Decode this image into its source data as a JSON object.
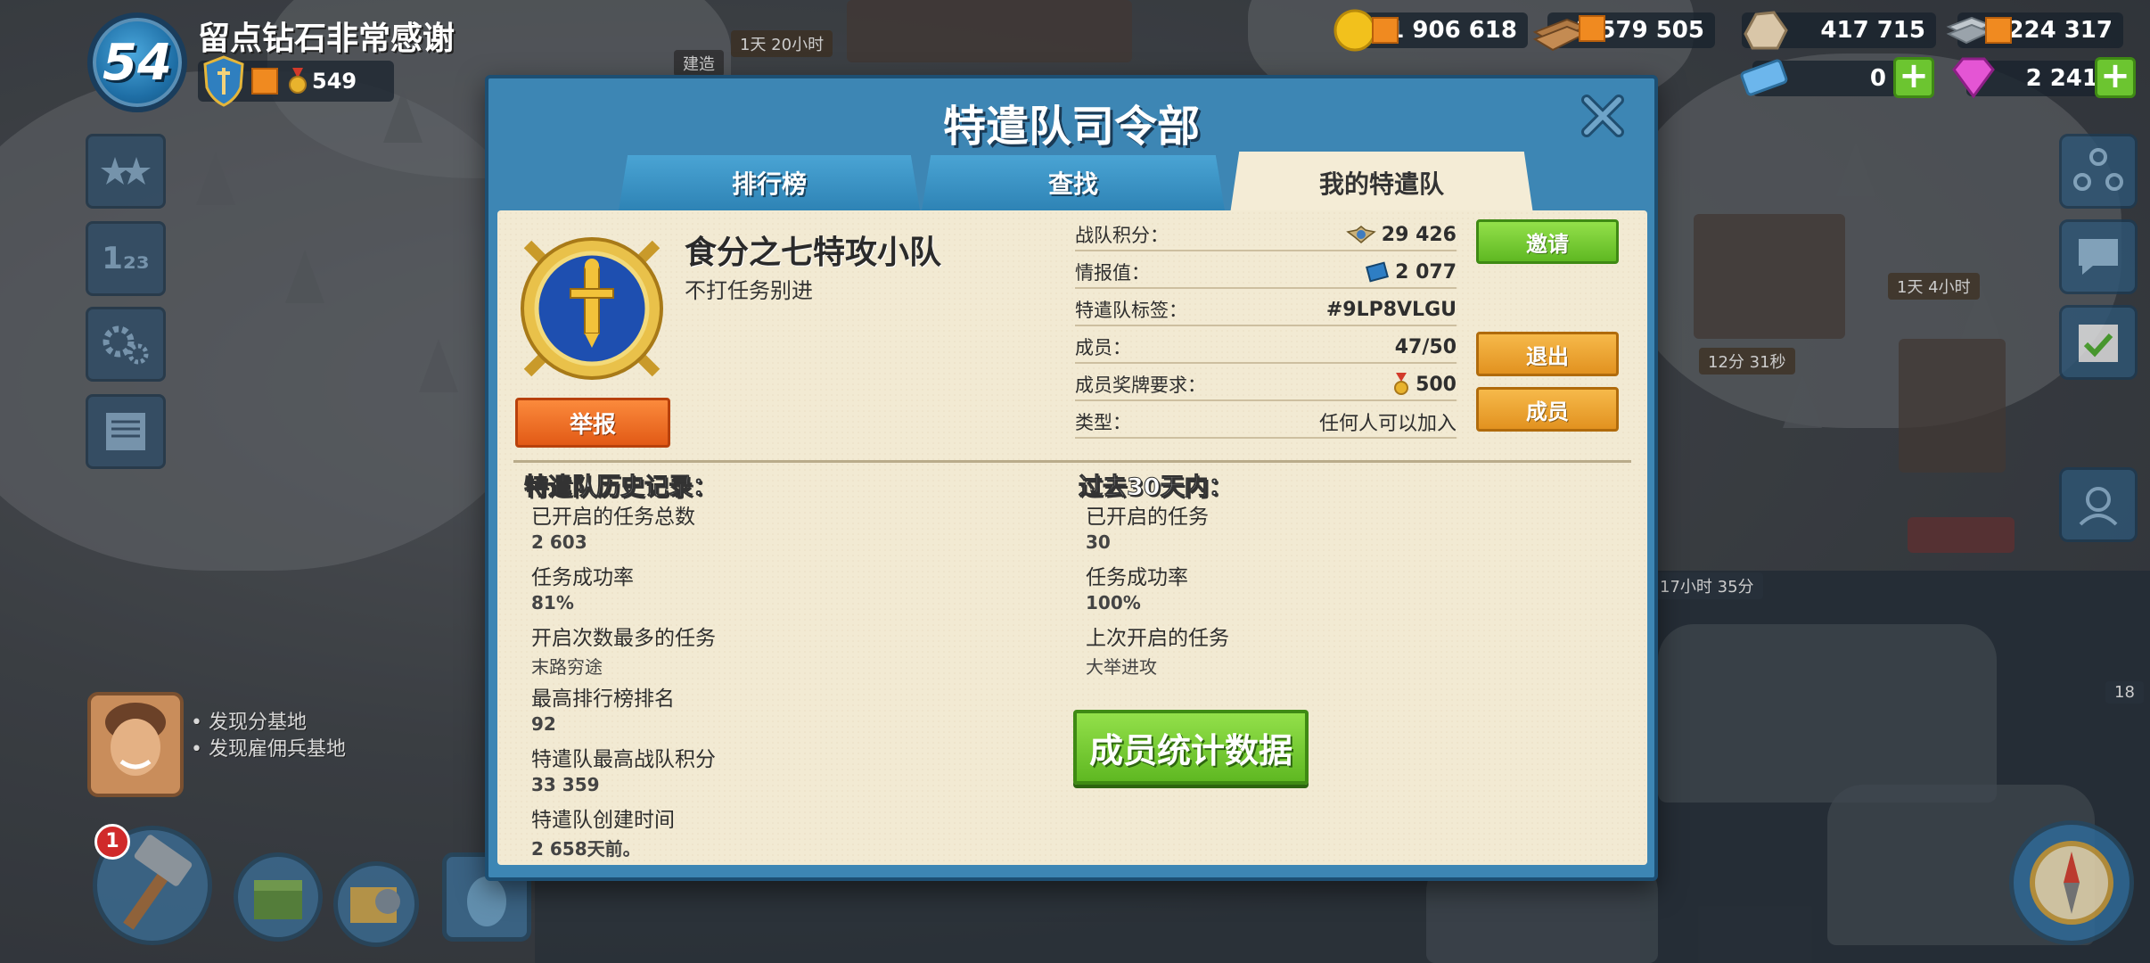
{
  "hud": {
    "level": "54",
    "player_name": "留点钻石非常感谢",
    "medal_count": "549",
    "advisor_lines": [
      "• 发现分基地",
      "• 发现雇佣兵基地"
    ],
    "hammer_badge": "1"
  },
  "resources": {
    "gold": "1 906 618",
    "wood": "1 579 505",
    "stone": "417 715",
    "iron": "1 224 317",
    "intel_tickets": "0",
    "diamonds": "2 241"
  },
  "map_labels": {
    "timer_1": "1天 20小时",
    "timer_2": "建造",
    "timer_3": "1天 4小时",
    "timer_4": "12分 31秒",
    "timer_5": "17小时 35分",
    "timer_6": "18"
  },
  "modal": {
    "title": "特遣队司令部",
    "tabs": [
      {
        "label": "排行榜"
      },
      {
        "label": "查找"
      },
      {
        "label": "我的特遣队"
      }
    ],
    "squad": {
      "name": "食分之七特攻小队",
      "description": "不打任务别进",
      "report_label": "举报"
    },
    "info": {
      "score_label": "战队积分：",
      "score_value": "29 426",
      "intel_label": "情报值：",
      "intel_value": "2 077",
      "tag_label": "特遣队标签：",
      "tag_value": "#9LP8VLGU",
      "members_label": "成员：",
      "members_value": "47/50",
      "medal_req_label": "成员奖牌要求：",
      "medal_req_value": "500",
      "type_label": "类型：",
      "type_value": "任何人可以加入"
    },
    "buttons": {
      "invite": "邀请",
      "leave": "退出",
      "members": "成员",
      "member_stats": "成员统计数据"
    },
    "history": {
      "title": "特遣队历史记录：",
      "items": [
        {
          "label": "已开启的任务总数",
          "value": "2 603"
        },
        {
          "label": "任务成功率",
          "value": "81%"
        },
        {
          "label": "开启次数最多的任务",
          "value": "末路穷途"
        },
        {
          "label": "最高排行榜排名",
          "value": "92"
        },
        {
          "label": "特遣队最高战队积分",
          "value": "33 359"
        },
        {
          "label": "特遣队创建时间",
          "value": "2 658天前。"
        }
      ]
    },
    "recent": {
      "title": "过去30天内：",
      "items": [
        {
          "label": "已开启的任务",
          "value": "30"
        },
        {
          "label": "任务成功率",
          "value": "100%"
        },
        {
          "label": "上次开启的任务",
          "value": "大举进攻"
        }
      ]
    }
  },
  "colors": {
    "modal_blue": "#3d86b4",
    "panel_cream": "#f2ead3",
    "button_green": "#6cc530",
    "button_orange": "#e29220",
    "report_red": "#e25a16"
  }
}
